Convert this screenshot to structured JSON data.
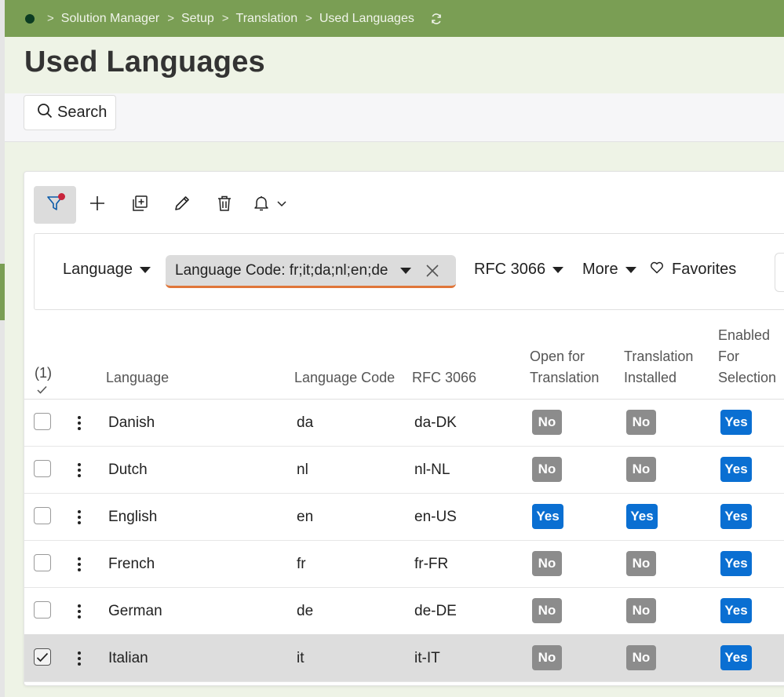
{
  "breadcrumbs": [
    "Solution Manager",
    "Setup",
    "Translation",
    "Used Languages"
  ],
  "page_title": "Used Languages",
  "search_label": "Search",
  "icons": [
    "home-dot-icon",
    "chevron-right-icon",
    "refresh-icon",
    "search-icon",
    "filter-icon",
    "plus-icon",
    "copy-icon",
    "pencil-icon",
    "trash-icon",
    "bell-icon",
    "chevron-down-icon",
    "caret-down-icon",
    "close-icon",
    "heart-icon",
    "checkmark-icon",
    "kebab-icon"
  ],
  "colors": {
    "topbar": "#7a9e54",
    "yes_badge": "#0a6fd2",
    "no_badge": "#8c8c8c",
    "filter_underline": "#e0763a",
    "notification_dot": "#c8243b"
  },
  "filters": {
    "language": "Language",
    "chip": "Language Code: fr;it;da;nl;en;de",
    "rfc": "RFC 3066",
    "more": "More",
    "favorites": "Favorites"
  },
  "table": {
    "selected_count": "(1)",
    "headers": {
      "language": "Language",
      "language_code": "Language Code",
      "rfc": "RFC 3066",
      "open_1": "Open for",
      "open_2": "Translation",
      "installed_1": "Translation",
      "installed_2": "Installed",
      "enabled_1": "Enabled",
      "enabled_2": "For",
      "enabled_3": "Selection"
    },
    "rows": [
      {
        "language": "Danish",
        "code": "da",
        "rfc": "da-DK",
        "open": "No",
        "installed": "No",
        "enabled": "Yes",
        "selected": false
      },
      {
        "language": "Dutch",
        "code": "nl",
        "rfc": "nl-NL",
        "open": "No",
        "installed": "No",
        "enabled": "Yes",
        "selected": false
      },
      {
        "language": "English",
        "code": "en",
        "rfc": "en-US",
        "open": "Yes",
        "installed": "Yes",
        "enabled": "Yes",
        "selected": false
      },
      {
        "language": "French",
        "code": "fr",
        "rfc": "fr-FR",
        "open": "No",
        "installed": "No",
        "enabled": "Yes",
        "selected": false
      },
      {
        "language": "German",
        "code": "de",
        "rfc": "de-DE",
        "open": "No",
        "installed": "No",
        "enabled": "Yes",
        "selected": false
      },
      {
        "language": "Italian",
        "code": "it",
        "rfc": "it-IT",
        "open": "No",
        "installed": "No",
        "enabled": "Yes",
        "selected": true
      }
    ]
  }
}
